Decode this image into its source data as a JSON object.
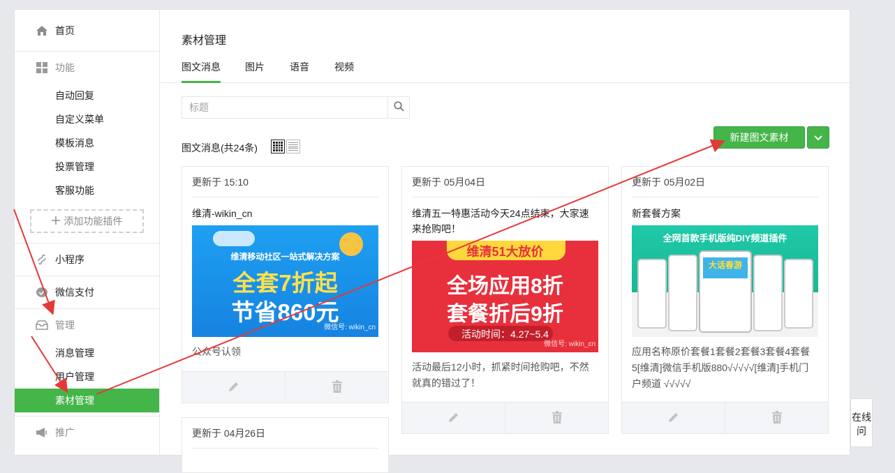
{
  "sidebar": {
    "home": "首页",
    "features": {
      "label": "功能",
      "items": [
        "自动回复",
        "自定义菜单",
        "模板消息",
        "投票管理",
        "客服功能"
      ],
      "add_plugin": "添加功能插件"
    },
    "mini_program": "小程序",
    "wechat_pay": "微信支付",
    "manage": {
      "label": "管理",
      "items": [
        "消息管理",
        "用户管理",
        "素材管理"
      ]
    },
    "promote": "推广"
  },
  "main": {
    "title": "素材管理",
    "tabs": [
      "图文消息",
      "图片",
      "语音",
      "视频"
    ],
    "search_placeholder": "标题",
    "count_label": "图文消息(共24条)",
    "new_button": "新建图文素材"
  },
  "cards": [
    {
      "date": "更新于 15:10",
      "title": "维清-wikin_cn",
      "img_lines": [
        "维清移动社区一站式解决方案",
        "全套7折起",
        "节省860元",
        "微信号: wikin_cn"
      ],
      "desc": "公众号认领"
    },
    {
      "date": "更新于 05月04日",
      "title": "维清五一特惠活动今天24点结束，大家速来抢购吧！",
      "img_lines": [
        "维清51大放价",
        "全场应用8折",
        "套餐折后9折",
        "活动时间：4.27~5.4",
        "微信号: wikin_cn"
      ],
      "desc": "活动最后12小时，抓紧时间抢购吧，不然就真的错过了！"
    },
    {
      "date": "更新于 05月02日",
      "title": "新套餐方案",
      "img_lines": [
        "全网首款手机版纯DIY频道插件",
        "大话春游"
      ],
      "desc": "应用名称原价套餐1套餐2套餐3套餐4套餐5[维清]微信手机版880√√√√√[维清]手机门户频道 √√√√√"
    },
    {
      "date": "更新于 04月26日"
    }
  ],
  "chat_tab": "在线问",
  "colors": {
    "accent": "#44b549",
    "arrow": "#e53935"
  }
}
